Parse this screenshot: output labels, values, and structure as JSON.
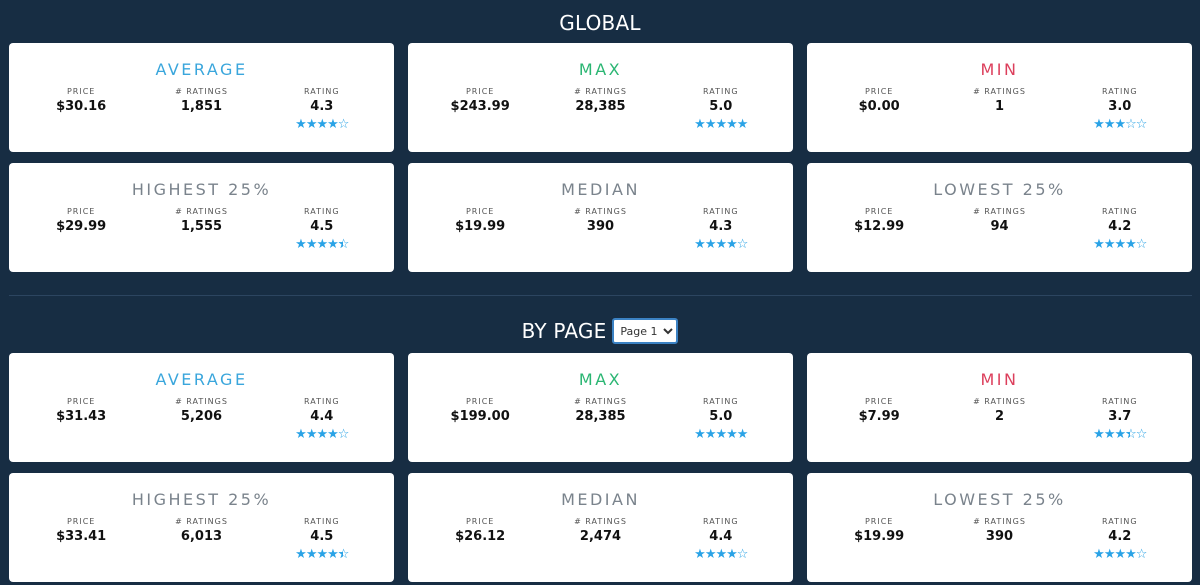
{
  "global": {
    "title": "GLOBAL",
    "cards": [
      {
        "title": "AVERAGE",
        "color": "#3aa6dc",
        "price": "$30.16",
        "ratings": "1,851",
        "rating": "4.3",
        "stars": 4.0
      },
      {
        "title": "MAX",
        "color": "#2bb673",
        "price": "$243.99",
        "ratings": "28,385",
        "rating": "5.0",
        "stars": 5.0
      },
      {
        "title": "MIN",
        "color": "#dc3f5c",
        "price": "$0.00",
        "ratings": "1",
        "rating": "3.0",
        "stars": 3.0
      },
      {
        "title": "HIGHEST 25%",
        "color": "#7a838c",
        "price": "$29.99",
        "ratings": "1,555",
        "rating": "4.5",
        "stars": 4.5
      },
      {
        "title": "MEDIAN",
        "color": "#7a838c",
        "price": "$19.99",
        "ratings": "390",
        "rating": "4.3",
        "stars": 4.0
      },
      {
        "title": "LOWEST 25%",
        "color": "#7a838c",
        "price": "$12.99",
        "ratings": "94",
        "rating": "4.2",
        "stars": 4.0
      }
    ]
  },
  "by_page": {
    "title": "BY PAGE",
    "select": {
      "selected": "Page 1"
    },
    "cards": [
      {
        "title": "AVERAGE",
        "color": "#3aa6dc",
        "price": "$31.43",
        "ratings": "5,206",
        "rating": "4.4",
        "stars": 4.0
      },
      {
        "title": "MAX",
        "color": "#2bb673",
        "price": "$199.00",
        "ratings": "28,385",
        "rating": "5.0",
        "stars": 5.0
      },
      {
        "title": "MIN",
        "color": "#dc3f5c",
        "price": "$7.99",
        "ratings": "2",
        "rating": "3.7",
        "stars": 3.5
      },
      {
        "title": "HIGHEST 25%",
        "color": "#7a838c",
        "price": "$33.41",
        "ratings": "6,013",
        "rating": "4.5",
        "stars": 4.5
      },
      {
        "title": "MEDIAN",
        "color": "#7a838c",
        "price": "$26.12",
        "ratings": "2,474",
        "rating": "4.4",
        "stars": 4.0
      },
      {
        "title": "LOWEST 25%",
        "color": "#7a838c",
        "price": "$19.99",
        "ratings": "390",
        "rating": "4.2",
        "stars": 4.0
      }
    ]
  },
  "labels": {
    "price": "PRICE",
    "ratings": "# RATINGS",
    "rating": "RATING"
  },
  "colors": {
    "background": "#172d43",
    "star": "#2aa3e6"
  }
}
